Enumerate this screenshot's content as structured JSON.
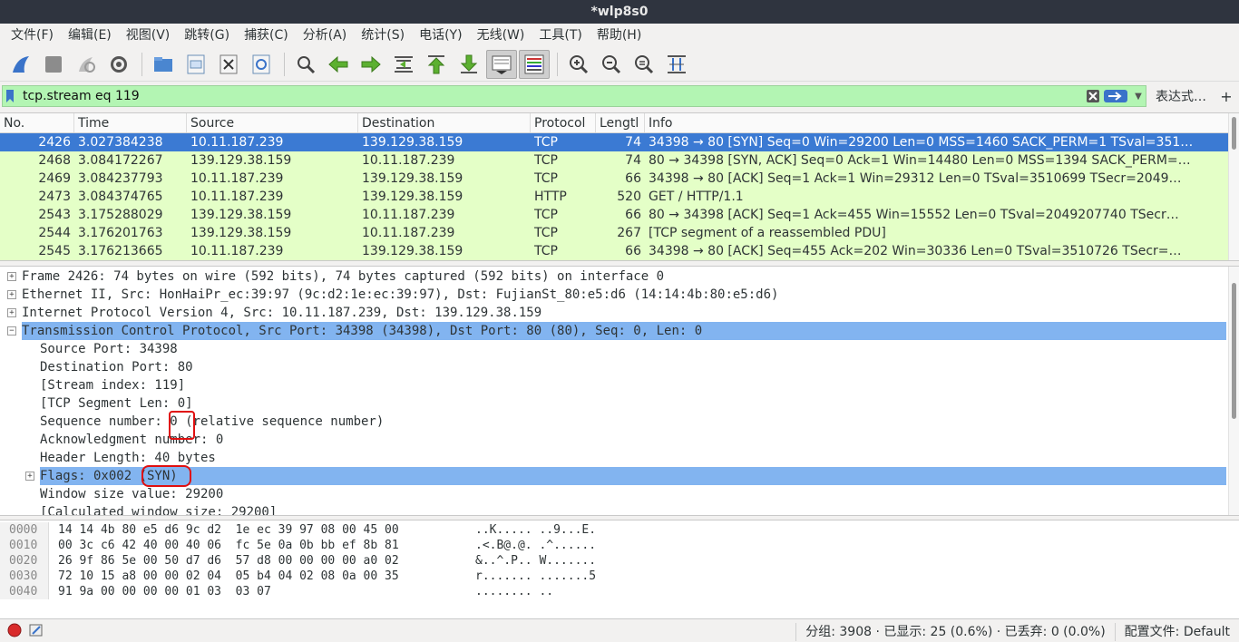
{
  "window": {
    "title": "*wlp8s0"
  },
  "menu": [
    "文件(F)",
    "编辑(E)",
    "视图(V)",
    "跳转(G)",
    "捕获(C)",
    "分析(A)",
    "统计(S)",
    "电话(Y)",
    "无线(W)",
    "工具(T)",
    "帮助(H)"
  ],
  "toolbar": {
    "icons": [
      "shark-fin-start-icon",
      "stop-capture-icon",
      "restart-capture-icon",
      "capture-options-icon",
      "open-file-icon",
      "save-file-icon",
      "close-file-icon",
      "reload-file-icon",
      "find-packet-icon",
      "go-back-icon",
      "go-forward-icon",
      "go-to-packet-icon",
      "go-first-packet-icon",
      "go-last-packet-icon",
      "autoscroll-icon",
      "colorize-icon",
      "zoom-in-icon",
      "zoom-out-icon",
      "zoom-normal-icon",
      "resize-columns-icon"
    ]
  },
  "filter": {
    "value": "tcp.stream eq 119",
    "expression_label": "表达式…",
    "plus_label": "+",
    "bg_color": "#b3f5b3"
  },
  "packet_list": {
    "columns": [
      "No.",
      "Time",
      "Source",
      "Destination",
      "Protocol",
      "Lengtl",
      "Info"
    ],
    "rows": [
      {
        "no": "2426",
        "time": "3.027384238",
        "src": "10.11.187.239",
        "dst": "139.129.38.159",
        "proto": "TCP",
        "len": "74",
        "info": "34398 → 80 [SYN] Seq=0 Win=29200 Len=0 MSS=1460 SACK_PERM=1 TSval=351…",
        "selected": true
      },
      {
        "no": "2468",
        "time": "3.084172267",
        "src": "139.129.38.159",
        "dst": "10.11.187.239",
        "proto": "TCP",
        "len": "74",
        "info": "80 → 34398 [SYN, ACK] Seq=0 Ack=1 Win=14480 Len=0 MSS=1394 SACK_PERM=…"
      },
      {
        "no": "2469",
        "time": "3.084237793",
        "src": "10.11.187.239",
        "dst": "139.129.38.159",
        "proto": "TCP",
        "len": "66",
        "info": "34398 → 80 [ACK] Seq=1 Ack=1 Win=29312 Len=0 TSval=3510699 TSecr=2049…"
      },
      {
        "no": "2473",
        "time": "3.084374765",
        "src": "10.11.187.239",
        "dst": "139.129.38.159",
        "proto": "HTTP",
        "len": "520",
        "info": "GET / HTTP/1.1"
      },
      {
        "no": "2543",
        "time": "3.175288029",
        "src": "139.129.38.159",
        "dst": "10.11.187.239",
        "proto": "TCP",
        "len": "66",
        "info": "80 → 34398 [ACK] Seq=1 Ack=455 Win=15552 Len=0 TSval=2049207740 TSecr…"
      },
      {
        "no": "2544",
        "time": "3.176201763",
        "src": "139.129.38.159",
        "dst": "10.11.187.239",
        "proto": "TCP",
        "len": "267",
        "info": "[TCP segment of a reassembled PDU]"
      },
      {
        "no": "2545",
        "time": "3.176213665",
        "src": "10.11.187.239",
        "dst": "139.129.38.159",
        "proto": "TCP",
        "len": "66",
        "info": "34398 → 80 [ACK] Seq=455 Ack=202 Win=30336 Len=0 TSval=3510726 TSecr=…"
      }
    ],
    "row_color": "#e4ffc7",
    "selected_color": "#3b7ad3"
  },
  "packet_detail": {
    "rows": [
      {
        "text": "Frame 2426: 74 bytes on wire (592 bits), 74 bytes captured (592 bits) on interface 0",
        "level": 0,
        "expander": "+"
      },
      {
        "text": "Ethernet II, Src: HonHaiPr_ec:39:97 (9c:d2:1e:ec:39:97), Dst: FujianSt_80:e5:d6 (14:14:4b:80:e5:d6)",
        "level": 0,
        "expander": "+"
      },
      {
        "text": "Internet Protocol Version 4, Src: 10.11.187.239, Dst: 139.129.38.159",
        "level": 0,
        "expander": "+"
      },
      {
        "text": "Transmission Control Protocol, Src Port: 34398 (34398), Dst Port: 80 (80), Seq: 0, Len: 0",
        "level": 0,
        "expander": "-",
        "selected": true
      },
      {
        "text": "Source Port: 34398",
        "level": 1
      },
      {
        "text": "Destination Port: 80",
        "level": 1
      },
      {
        "text": "[Stream index: 119]",
        "level": 1
      },
      {
        "text": "[TCP Segment Len: 0]",
        "level": 1
      },
      {
        "text": "Sequence number: 0    (relative sequence number)",
        "level": 1
      },
      {
        "text": "Acknowledgment number: 0",
        "level": 1
      },
      {
        "text": "Header Length: 40 bytes",
        "level": 1
      },
      {
        "text": "Flags: 0x002 (SYN)",
        "level": 1,
        "expander": "+",
        "subselected": true
      },
      {
        "text": "Window size value: 29200",
        "level": 1
      },
      {
        "text": "[Calculated window size: 29200]",
        "level": 1
      }
    ]
  },
  "packet_bytes": {
    "rows": [
      {
        "offset": "0000",
        "hex": "14 14 4b 80 e5 d6 9c d2  1e ec 39 97 08 00 45 00",
        "ascii": "..K..... ..9...E."
      },
      {
        "offset": "0010",
        "hex": "00 3c c6 42 40 00 40 06  fc 5e 0a 0b bb ef 8b 81",
        "ascii": ".<.B@.@. .^......"
      },
      {
        "offset": "0020",
        "hex": "26 9f 86 5e 00 50 d7 d6  57 d8 00 00 00 00 a0 02",
        "ascii": "&..^.P.. W......."
      },
      {
        "offset": "0030",
        "hex": "72 10 15 a8 00 00 02 04  05 b4 04 02 08 0a 00 35",
        "ascii": "r....... .......5"
      },
      {
        "offset": "0040",
        "hex": "91 9a 00 00 00 00 01 03  03 07",
        "ascii": "........ .."
      }
    ]
  },
  "status": {
    "packets": "分组: 3908 · 已显示: 25 (0.6%) · 已丢弃: 0 (0.0%)",
    "profile": "配置文件: Default"
  }
}
